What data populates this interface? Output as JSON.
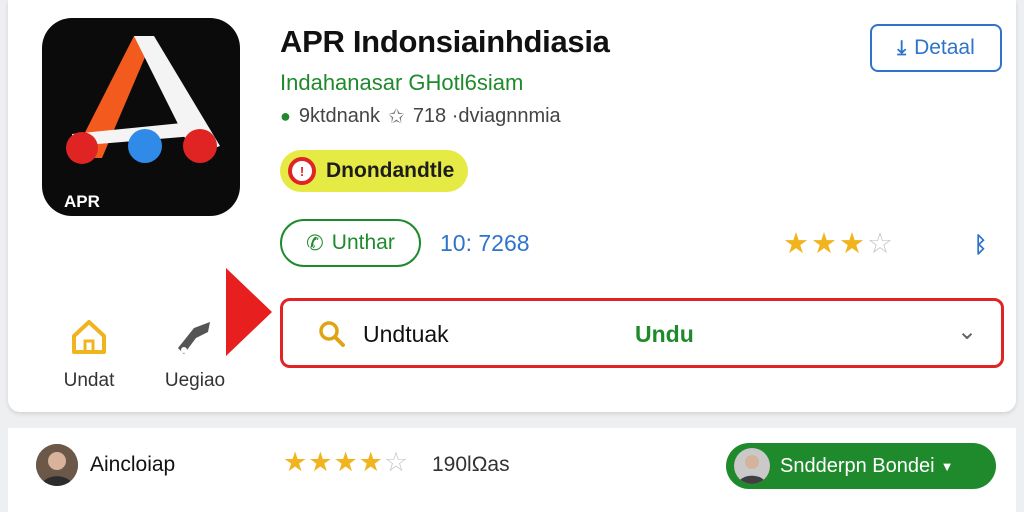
{
  "app": {
    "icon_label": "APR",
    "title": "APR Indonsiainhdiasia",
    "developer": "Indahanasar GHotl6siam",
    "meta_left": "9ktdnank",
    "meta_right": "718 ·dviagnnmia",
    "badge": "Dnondandtle",
    "detail_button": "Detaal",
    "call_button": "Unthar",
    "counter": "10: 7268",
    "rating": {
      "filled": 3,
      "total": 4
    }
  },
  "nav": {
    "home_label": "Undat",
    "second_label": "Uegiao"
  },
  "search": {
    "label": "Undtuak",
    "value": "Undu"
  },
  "review": {
    "name": "Aincloiap",
    "rating": {
      "filled": 4,
      "total": 5
    },
    "count": "190lΩas",
    "subscribe_label": "Sndderpn Bondei"
  },
  "colors": {
    "accent_blue": "#2f74c8",
    "accent_green": "#1f8a2c",
    "alert_red": "#e02424",
    "badge_yellow": "#e6ea44",
    "star": "#f0b41f"
  },
  "icons": [
    "leaf-icon",
    "star-outline-icon",
    "alert-icon",
    "download-icon",
    "phone-icon",
    "bluetooth-icon",
    "home-icon",
    "hammer-icon",
    "search-icon",
    "chevron-down-icon"
  ]
}
